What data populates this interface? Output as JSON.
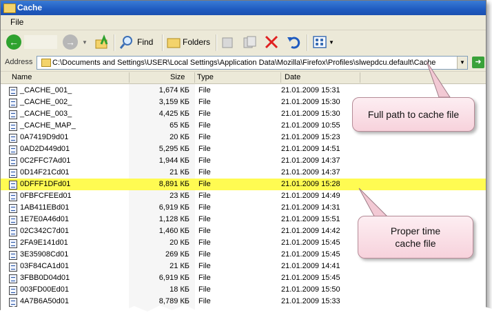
{
  "window": {
    "title": "Cache"
  },
  "menu": {
    "file": "File"
  },
  "toolbar": {
    "find": "Find",
    "folders": "Folders"
  },
  "address": {
    "label": "Address",
    "path": "C:\\Documents and Settings\\USER\\Local Settings\\Application Data\\Mozilla\\Firefox\\Profiles\\slwepdcu.default\\Cache"
  },
  "columns": {
    "name": "Name",
    "size": "Size",
    "type": "Type",
    "date": "Date"
  },
  "files": [
    {
      "name": "_CACHE_001_",
      "size": "1,674 КБ",
      "type": "File",
      "date": "21.01.2009 15:31"
    },
    {
      "name": "_CACHE_002_",
      "size": "3,159 КБ",
      "type": "File",
      "date": "21.01.2009 15:30"
    },
    {
      "name": "_CACHE_003_",
      "size": "4,425 КБ",
      "type": "File",
      "date": "21.01.2009 15:30"
    },
    {
      "name": "_CACHE_MAP_",
      "size": "65 КБ",
      "type": "File",
      "date": "21.01.2009 10:55"
    },
    {
      "name": "0A7419D9d01",
      "size": "20 КБ",
      "type": "File",
      "date": "21.01.2009 15:23"
    },
    {
      "name": "0AD2D449d01",
      "size": "5,295 КБ",
      "type": "File",
      "date": "21.01.2009 14:51"
    },
    {
      "name": "0C2FFC7Ad01",
      "size": "1,944 КБ",
      "type": "File",
      "date": "21.01.2009 14:37"
    },
    {
      "name": "0D14F21Cd01",
      "size": "21 КБ",
      "type": "File",
      "date": "21.01.2009 14:37"
    },
    {
      "name": "0DFFF1DFd01",
      "size": "8,891 КБ",
      "type": "File",
      "date": "21.01.2009 15:28",
      "highlighted": true
    },
    {
      "name": "0FBFCFEEd01",
      "size": "23 КБ",
      "type": "File",
      "date": "21.01.2009 14:49"
    },
    {
      "name": "1AB411EBd01",
      "size": "6,919 КБ",
      "type": "File",
      "date": "21.01.2009 14:31"
    },
    {
      "name": "1E7E0A46d01",
      "size": "1,128 КБ",
      "type": "File",
      "date": "21.01.2009 15:51"
    },
    {
      "name": "02C342C7d01",
      "size": "1,460 КБ",
      "type": "File",
      "date": "21.01.2009 14:42"
    },
    {
      "name": "2FA9E141d01",
      "size": "20 КБ",
      "type": "File",
      "date": "21.01.2009 15:45"
    },
    {
      "name": "3E35908Cd01",
      "size": "269 КБ",
      "type": "File",
      "date": "21.01.2009 15:45"
    },
    {
      "name": "03F84CA1d01",
      "size": "21 КБ",
      "type": "File",
      "date": "21.01.2009 14:41"
    },
    {
      "name": "3FBB0D04d01",
      "size": "6,919 КБ",
      "type": "File",
      "date": "21.01.2009 15:45"
    },
    {
      "name": "003FD00Ed01",
      "size": "18 КБ",
      "type": "File",
      "date": "21.01.2009 15:50"
    },
    {
      "name": "4A7B6A50d01",
      "size": "8,789 КБ",
      "type": "File",
      "date": "21.01.2009 15:33"
    }
  ],
  "callouts": {
    "path": "Full path to cache file",
    "time": "Proper time cache file"
  },
  "colors": {
    "highlight": "#fffb52",
    "titlebar": "#1f5bc0",
    "callout": "#f7d2dc"
  },
  "icons": [
    "back-icon",
    "forward-icon",
    "up-folder-icon",
    "search-icon",
    "folders-icon",
    "move-to-icon",
    "copy-to-icon",
    "delete-icon",
    "undo-icon",
    "views-icon",
    "go-icon",
    "file-icon"
  ]
}
